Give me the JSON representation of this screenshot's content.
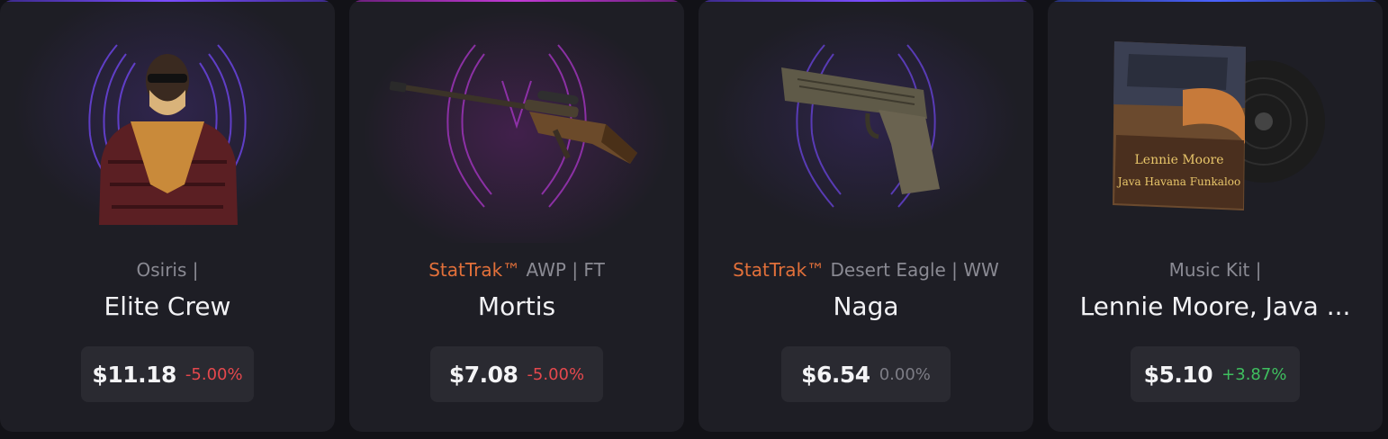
{
  "colors": {
    "card_bg": "#1e1e25",
    "pill_bg": "#2a2a31",
    "stattrak": "#e2703a",
    "negative": "#e5484d",
    "neutral": "#7d7d86",
    "positive": "#3fbf5f"
  },
  "cards": [
    {
      "stattrak": "",
      "subtitle": "Osiris |",
      "title": "Elite Crew",
      "price": "$11.18",
      "change": "-5.00%",
      "change_type": "negative",
      "accent": "#7b4dff",
      "icon": "agent-icon"
    },
    {
      "stattrak": "StatTrak™",
      "subtitle": "AWP | FT",
      "title": "Mortis",
      "price": "$7.08",
      "change": "-5.00%",
      "change_type": "negative",
      "accent": "#c13ad4",
      "icon": "sniper-rifle-icon"
    },
    {
      "stattrak": "StatTrak™",
      "subtitle": "Desert Eagle | WW",
      "title": "Naga",
      "price": "$6.54",
      "change": "0.00%",
      "change_type": "neutral",
      "accent": "#7b4dff",
      "icon": "pistol-icon"
    },
    {
      "stattrak": "",
      "subtitle": "Music Kit |",
      "title": "Lennie Moore, Java ...",
      "price": "$5.10",
      "change": "+3.87%",
      "change_type": "positive",
      "accent": "#4a63ff",
      "icon": "music-kit-icon",
      "art_text": [
        "Lennie Moore",
        "Java Havana Funkaloo"
      ]
    }
  ]
}
